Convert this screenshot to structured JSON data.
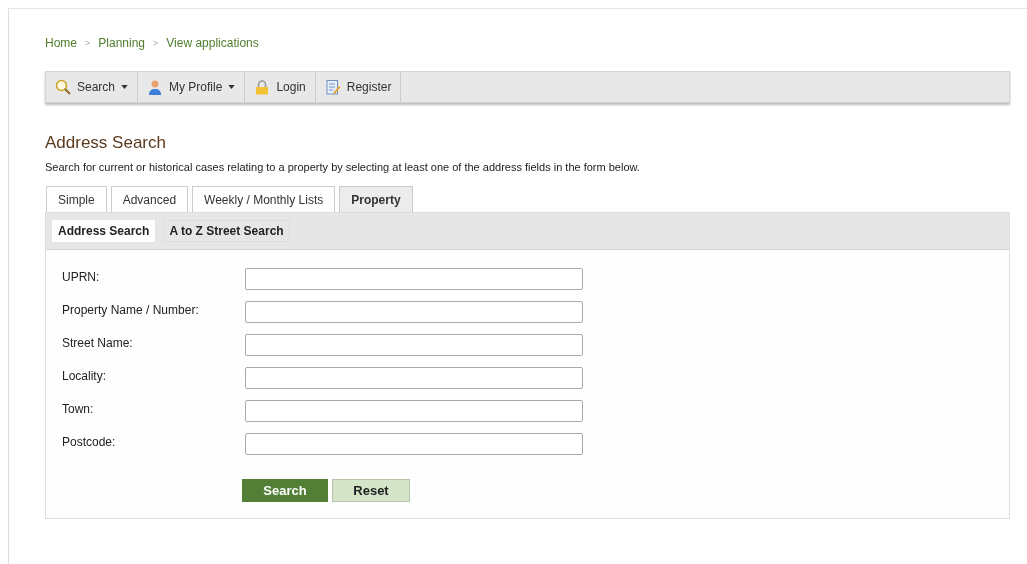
{
  "breadcrumb": {
    "separator": ">",
    "items": [
      "Home",
      "Planning",
      "View applications"
    ]
  },
  "toolbar": [
    {
      "label": "Search",
      "kind": "search",
      "dropdown": true
    },
    {
      "label": "My Profile",
      "kind": "profile",
      "dropdown": true
    },
    {
      "label": "Login",
      "kind": "login",
      "dropdown": false
    },
    {
      "label": "Register",
      "kind": "register",
      "dropdown": false
    }
  ],
  "heading": "Address Search",
  "intro": "Search for current or historical cases relating to a property by selecting at least one of the address fields in the form below.",
  "tabs": [
    {
      "label": "Simple",
      "selected": false
    },
    {
      "label": "Advanced",
      "selected": false
    },
    {
      "label": "Weekly / Monthly Lists",
      "selected": false
    },
    {
      "label": "Property",
      "selected": true
    }
  ],
  "subtabs": [
    {
      "label": "Address Search",
      "selected": true
    },
    {
      "label": "A to Z Street Search",
      "selected": false
    }
  ],
  "fields": [
    "UPRN:",
    "Property Name / Number:",
    "Street Name:",
    "Locality:",
    "Town:",
    "Postcode:"
  ],
  "buttons": [
    {
      "label": "Search",
      "kind": "primary"
    },
    {
      "label": "Reset",
      "kind": "secondary"
    }
  ]
}
